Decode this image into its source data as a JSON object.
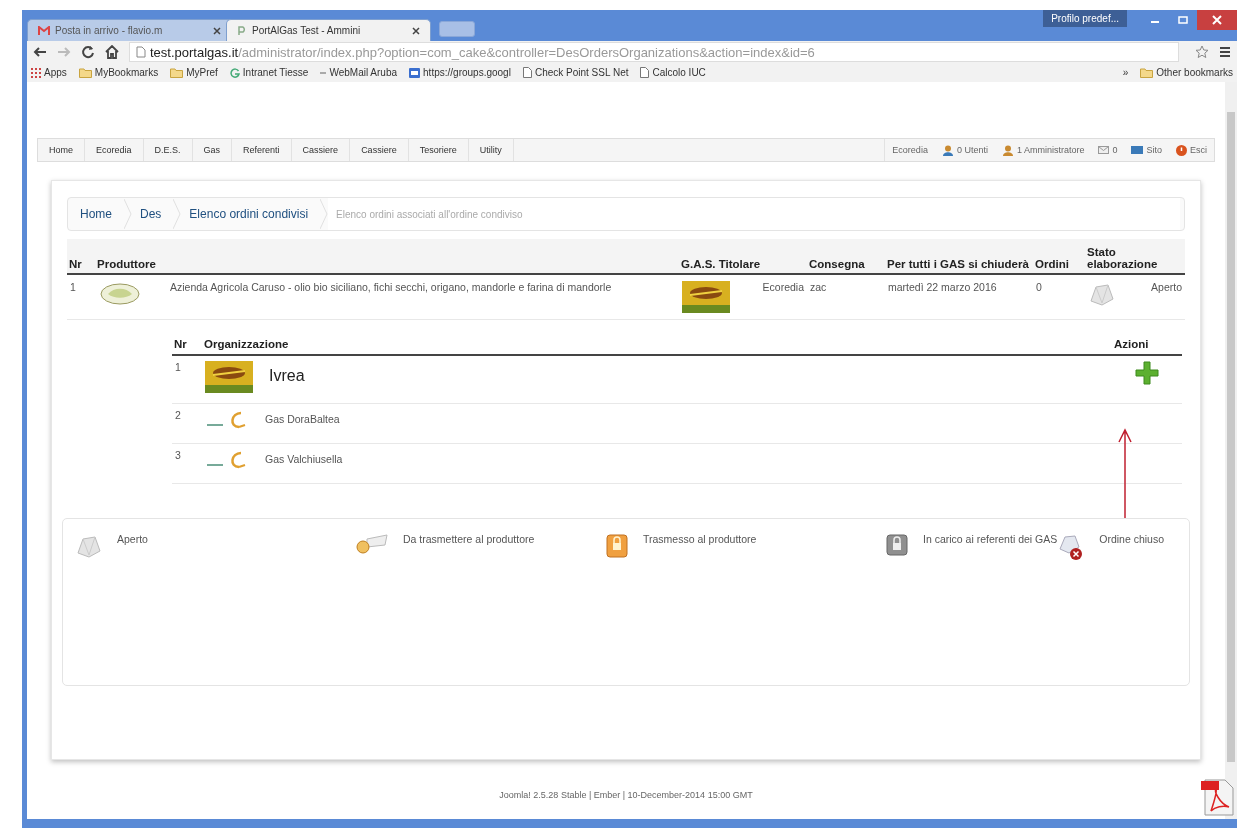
{
  "browser": {
    "tabs": [
      {
        "label": "Posta in arrivo - flavio.m",
        "kind": "mail",
        "selected": false
      },
      {
        "label": "PortAlGas Test - Ammini",
        "kind": "site",
        "selected": true
      }
    ],
    "profile": "Profilo predef...",
    "url_host": "test.portalgas.it",
    "url_path": "/administrator/index.php?option=com_cake&controller=DesOrdersOrganizations&action=index&id=6",
    "bookmarks": [
      {
        "label": "Apps",
        "kind": "apps"
      },
      {
        "label": "MyBookmarks",
        "kind": "folder"
      },
      {
        "label": "MyPref",
        "kind": "folder"
      },
      {
        "label": "Intranet Tiesse",
        "kind": "google"
      },
      {
        "label": "WebMail Aruba",
        "kind": "plain"
      },
      {
        "label": "https://groups.googl",
        "kind": "groups"
      },
      {
        "label": "Check Point SSL Net",
        "kind": "page"
      },
      {
        "label": "Calcolo IUC",
        "kind": "page"
      }
    ],
    "more_bookmarks": "»",
    "other_bookmarks": "Other bookmarks"
  },
  "admin_menu": {
    "items": [
      "Home",
      "Ecoredia",
      "D.E.S.",
      "Gas",
      "Referenti",
      "Cassiere",
      "Cassiere",
      "Tesoriere",
      "Utility"
    ],
    "status": [
      {
        "label": "Ecoredia",
        "kind": "text"
      },
      {
        "label": "0 Utenti",
        "kind": "users"
      },
      {
        "label": "1 Amministratore",
        "kind": "admin"
      },
      {
        "label": "0",
        "kind": "mail"
      },
      {
        "label": "Sito",
        "kind": "site"
      },
      {
        "label": "Esci",
        "kind": "logout"
      }
    ]
  },
  "breadcrumb": [
    {
      "label": "Home",
      "selected": false
    },
    {
      "label": "Des",
      "selected": false
    },
    {
      "label": "Elenco ordini condivisi",
      "selected": false
    },
    {
      "label": "Elenco ordini associati all'ordine condiviso",
      "selected": true
    }
  ],
  "orders": {
    "columns": [
      "Nr",
      "Produttore",
      "G.A.S. Titolare",
      "Consegna",
      "Per tutti i GAS si chiuderà",
      "Ordini",
      "Stato elaborazione"
    ],
    "rows": [
      {
        "nr": "1",
        "producer": "Azienda Agricola Caruso - olio bio siciliano, fichi secchi, origano, mandorle e farina di mandorle",
        "gas": "Ecoredia",
        "delivery": "zac",
        "closes": "martedì 22 marzo 2016",
        "orders": "0",
        "status": {
          "kind": "open",
          "label": "Aperto"
        }
      }
    ]
  },
  "organizations": {
    "columns": [
      "Nr",
      "Organizzazione",
      "Azioni"
    ],
    "rows": [
      {
        "nr": "1",
        "name": "Ivrea",
        "kind": "gas",
        "can_add": true
      },
      {
        "nr": "2",
        "name": "Gas DoraBaltea",
        "kind": "portal",
        "can_add": false
      },
      {
        "nr": "3",
        "name": "Gas Valchiusella",
        "kind": "portal",
        "can_add": false
      }
    ]
  },
  "legend": [
    {
      "kind": "open",
      "label": "Aperto"
    },
    {
      "kind": "to-send",
      "label": "Da trasmettere al produttore"
    },
    {
      "kind": "sent",
      "label": "Trasmesso al produttore"
    },
    {
      "kind": "in-charge",
      "label": "In carico ai referenti dei GAS"
    },
    {
      "kind": "closed",
      "label": "Ordine chiuso"
    }
  ],
  "footer": "Joomla! 2.5.28 Stable | Ember | 10-December-2014 15:00 GMT"
}
